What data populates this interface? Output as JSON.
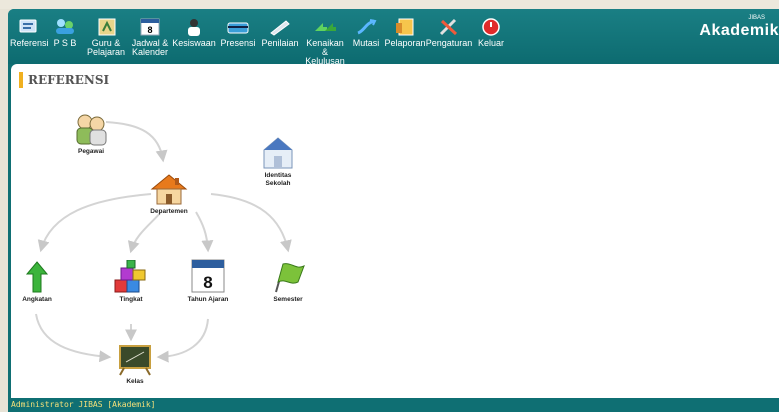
{
  "toolbar": {
    "items": [
      {
        "label": "Referensi",
        "icon": "book-icon"
      },
      {
        "label": "P S B",
        "icon": "users-icon"
      },
      {
        "label": "Guru & Pelajaran",
        "icon": "teacher-icon"
      },
      {
        "label": "Jadwal & Kalender",
        "icon": "calendar-icon"
      },
      {
        "label": "Kesiswaan",
        "icon": "students-icon"
      },
      {
        "label": "Presensi",
        "icon": "card-icon"
      },
      {
        "label": "Penilaian",
        "icon": "pen-icon"
      },
      {
        "label": "Kenaikan & Kelulusan",
        "icon": "arrows-icon"
      },
      {
        "label": "Mutasi",
        "icon": "mutation-icon"
      },
      {
        "label": "Pelaporan",
        "icon": "report-icon"
      },
      {
        "label": "Pengaturan",
        "icon": "tools-icon"
      },
      {
        "label": "Keluar",
        "icon": "power-icon"
      }
    ],
    "brand": "Akademik",
    "brand_super": "JIBAS"
  },
  "panel": {
    "title": "REFERENSI",
    "nodes": {
      "pegawai": "Pegawai",
      "identitas": "Identitas Sekolah",
      "departemen": "Departemen",
      "angkatan": "Angkatan",
      "tingkat": "Tingkat",
      "tahun": "Tahun Ajaran",
      "tahun_num": "8",
      "semester": "Semester",
      "kelas": "Kelas"
    }
  },
  "status": "Administrator JIBAS [Akademik]",
  "colors": {
    "accent": "#0f6f73",
    "title_bar": "#f0b020",
    "status_text": "#f4e07a"
  }
}
